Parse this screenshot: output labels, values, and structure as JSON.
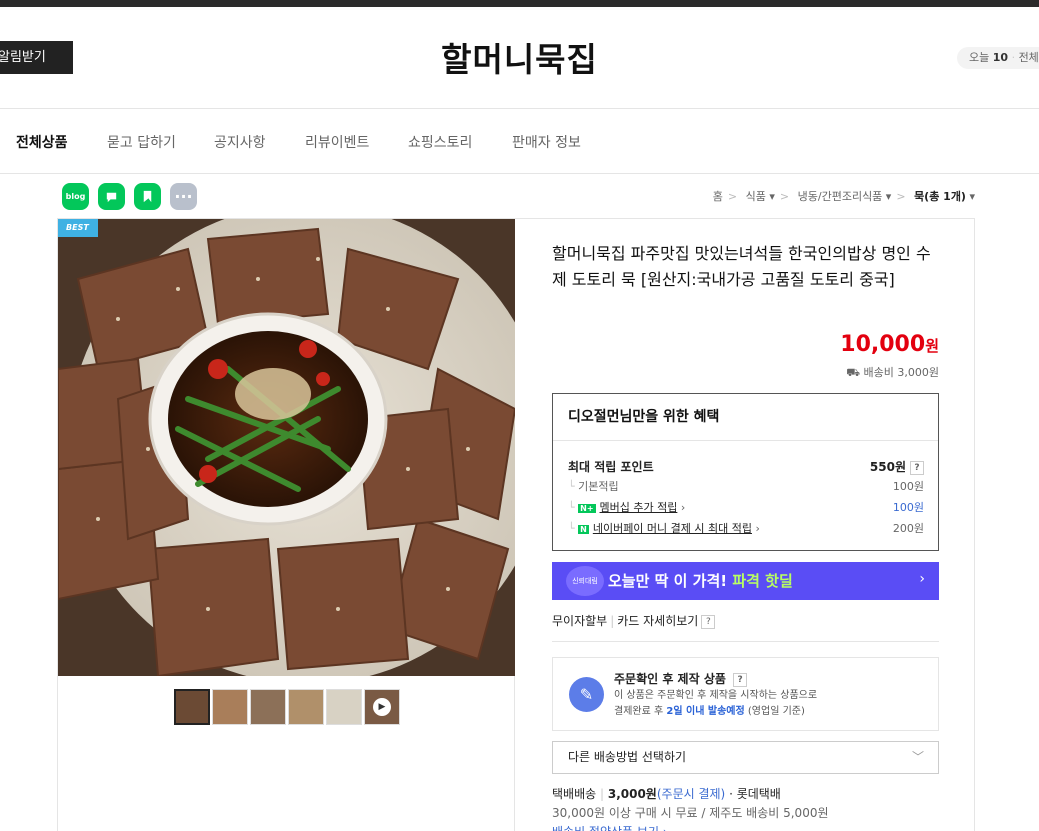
{
  "header": {
    "alarm_button": "알림받기",
    "store_name": "할머니묵집",
    "visit_today_label": "오늘",
    "visit_today_count": "10",
    "visit_total_label": "전체"
  },
  "nav": {
    "items": [
      "전체상품",
      "묻고 답하기",
      "공지사항",
      "리뷰이벤트",
      "쇼핑스토리",
      "판매자 정보"
    ]
  },
  "share": {
    "icons": [
      "blog-icon",
      "talk-icon",
      "band-icon",
      "more-icon"
    ],
    "blog_label": "blog"
  },
  "breadcrumb": {
    "items": [
      "홈",
      "식품",
      "냉동/간편조리식품",
      "묵(총 1개)"
    ]
  },
  "product": {
    "badge": "BEST",
    "title": "할머니묵집 파주맛집 맛있는녀석들 한국인의밥상 명인 수제 도토리 묵 [원산지:국내가공 고품질 도토리 중국]",
    "price": "10,000",
    "price_unit": "원",
    "shipping_fee": "배송비 3,000원"
  },
  "benefit": {
    "heading": "디오절먼님만을 위한 혜택",
    "max_point_label": "최대 적립 포인트",
    "max_point_value": "550원",
    "rows": [
      {
        "label": "기본적립",
        "value": "100원"
      },
      {
        "label": "멤버십 추가 적립",
        "value": "100원"
      },
      {
        "label": "네이버페이 머니 결제 시 최대 적립",
        "value": "200원"
      }
    ],
    "help": "?"
  },
  "deal": {
    "badge": "신뢰대림",
    "text_main": "오늘만 딱 이 가격!",
    "text_highlight": "파격 핫딜",
    "arrow": "›"
  },
  "card": {
    "installment": "무이자할부",
    "card_detail": "카드 자세히보기",
    "help": "?"
  },
  "made_to_order": {
    "title": "주문확인 후 제작 상품",
    "help": "?",
    "desc1": "이 상품은 주문확인 후 제작을 시작하는 상품으로",
    "desc2_prefix": "결제완료 후",
    "desc2_highlight": "2일 이내 발송예정",
    "desc2_suffix": "(영업일 기준)"
  },
  "shipping": {
    "select_label": "다른 배송방법 선택하기",
    "method": "택배배송",
    "fee": "3,000원",
    "fee_note": "(주문시 결제)",
    "carrier": "· 롯데택배",
    "free_note": "30,000원 이상 구매 시 무료 / 제주도 배송비 5,000원",
    "bundle_link": "배송비 절약상품 보기 ›"
  },
  "colors": {
    "price_red": "#e3000f",
    "deal_purple": "#5a4df5",
    "deal_highlight": "#b8ff62",
    "naver_green": "#03c75a",
    "link_blue": "#3a6ad0"
  }
}
